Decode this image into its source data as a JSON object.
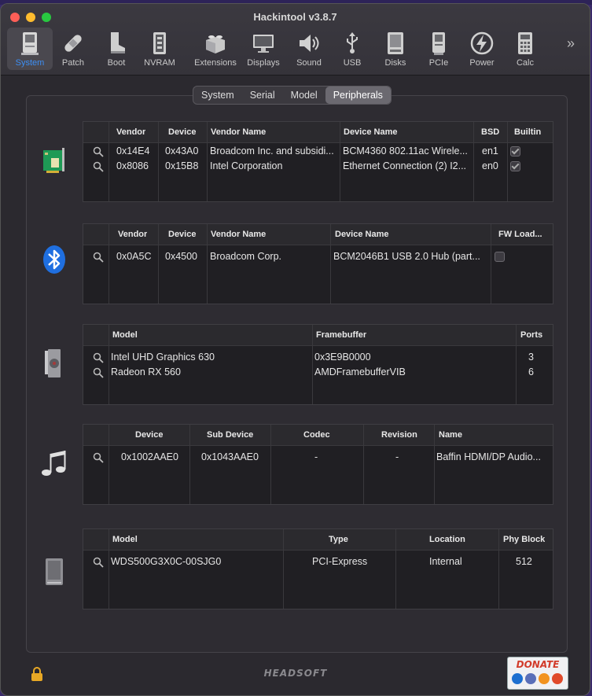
{
  "window": {
    "title": "Hackintool v3.8.7"
  },
  "toolbar": {
    "items": [
      {
        "label": "System",
        "icon": "system-icon",
        "active": true
      },
      {
        "label": "Patch",
        "icon": "bandage-icon"
      },
      {
        "label": "Boot",
        "icon": "boot-icon"
      },
      {
        "label": "NVRAM",
        "icon": "nvram-chip-icon"
      },
      {
        "label": "Extensions",
        "icon": "lego-brick-icon"
      },
      {
        "label": "Displays",
        "icon": "display-icon"
      },
      {
        "label": "Sound",
        "icon": "speaker-icon"
      },
      {
        "label": "USB",
        "icon": "usb-icon"
      },
      {
        "label": "Disks",
        "icon": "disk-icon"
      },
      {
        "label": "PCIe",
        "icon": "pcie-card-icon"
      },
      {
        "label": "Power",
        "icon": "power-bolt-icon"
      },
      {
        "label": "Calc",
        "icon": "calculator-icon"
      }
    ],
    "more": "»"
  },
  "tabs": [
    {
      "label": "System"
    },
    {
      "label": "Serial"
    },
    {
      "label": "Model"
    },
    {
      "label": "Peripherals",
      "active": true
    }
  ],
  "network": {
    "headers": [
      "Vendor",
      "Device",
      "Vendor Name",
      "Device Name",
      "BSD",
      "Builtin"
    ],
    "rows": [
      {
        "vendor": "0x14E4",
        "device": "0x43A0",
        "vendor_name": "Broadcom Inc. and subsidi...",
        "device_name": "BCM4360 802.11ac Wirele...",
        "bsd": "en1",
        "builtin": true
      },
      {
        "vendor": "0x8086",
        "device": "0x15B8",
        "vendor_name": "Intel Corporation",
        "device_name": "Ethernet Connection (2) I2...",
        "bsd": "en0",
        "builtin": true
      }
    ]
  },
  "bluetooth": {
    "headers": [
      "Vendor",
      "Device",
      "Vendor Name",
      "Device Name",
      "FW Load..."
    ],
    "rows": [
      {
        "vendor": "0x0A5C",
        "device": "0x4500",
        "vendor_name": "Broadcom Corp.",
        "device_name": "BCM2046B1 USB 2.0 Hub (part...",
        "fw_loaded": false
      }
    ]
  },
  "graphics": {
    "headers": [
      "Model",
      "Framebuffer",
      "Ports"
    ],
    "rows": [
      {
        "model": "Intel UHD Graphics 630",
        "framebuffer": "0x3E9B0000",
        "ports": "3"
      },
      {
        "model": "Radeon RX 560",
        "framebuffer": "AMDFramebufferVIB",
        "ports": "6"
      }
    ]
  },
  "audio": {
    "headers": [
      "Device",
      "Sub Device",
      "Codec",
      "Revision",
      "Name"
    ],
    "rows": [
      {
        "device": "0x1002AAE0",
        "sub_device": "0x1043AAE0",
        "codec": "-",
        "revision": "-",
        "name": "Baffin HDMI/DP Audio..."
      }
    ]
  },
  "storage": {
    "headers": [
      "Model",
      "Type",
      "Location",
      "Phy Block"
    ],
    "rows": [
      {
        "model": "WDS500G3X0C-00SJG0",
        "type": "PCI-Express",
        "location": "Internal",
        "phy_block": "512"
      }
    ]
  },
  "footer": {
    "brand": "HEADSOFT",
    "donate": "DONATE"
  },
  "colors": {
    "accent": "#3d8ff5",
    "window_bg": "#2b292f",
    "table_bg": "#201f23"
  }
}
